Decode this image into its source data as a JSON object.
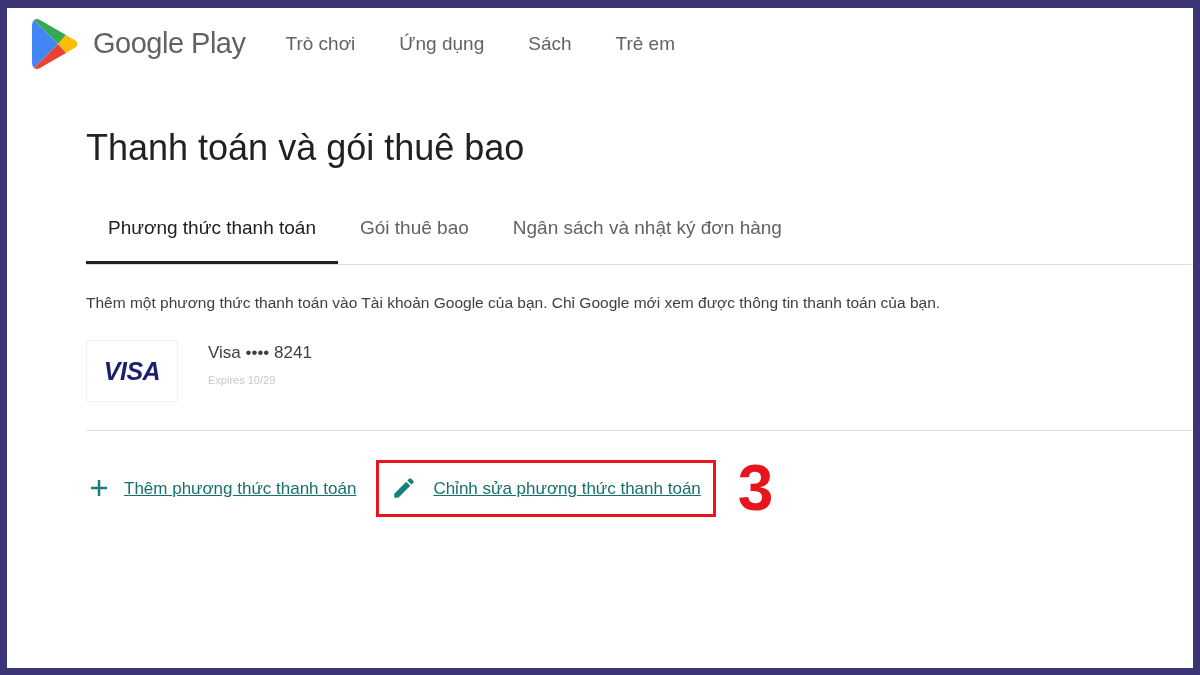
{
  "header": {
    "brand": "Google Play",
    "nav": [
      {
        "label": "Trò chơi"
      },
      {
        "label": "Ứng dụng"
      },
      {
        "label": "Sách"
      },
      {
        "label": "Trẻ em"
      }
    ]
  },
  "page": {
    "title": "Thanh toán và gói thuê bao",
    "tabs": [
      {
        "label": "Phương thức thanh toán",
        "selected": true
      },
      {
        "label": "Gói thuê bao",
        "selected": false
      },
      {
        "label": "Ngân sách và nhật ký đơn hàng",
        "selected": false
      }
    ],
    "description": "Thêm một phương thức thanh toán vào Tài khoản Google của bạn. Chỉ Google mới xem được thông tin thanh toán của bạn.",
    "card": {
      "logo": "VISA",
      "name": "Visa •••• 8241",
      "expires": "Expires 10/29"
    },
    "actions": [
      {
        "kind": "add",
        "label": "Thêm phương thức thanh toán",
        "highlighted": false
      },
      {
        "kind": "edit",
        "label": "Chỉnh sửa phương thức thanh toán",
        "highlighted": true
      }
    ],
    "step_label": "3"
  }
}
